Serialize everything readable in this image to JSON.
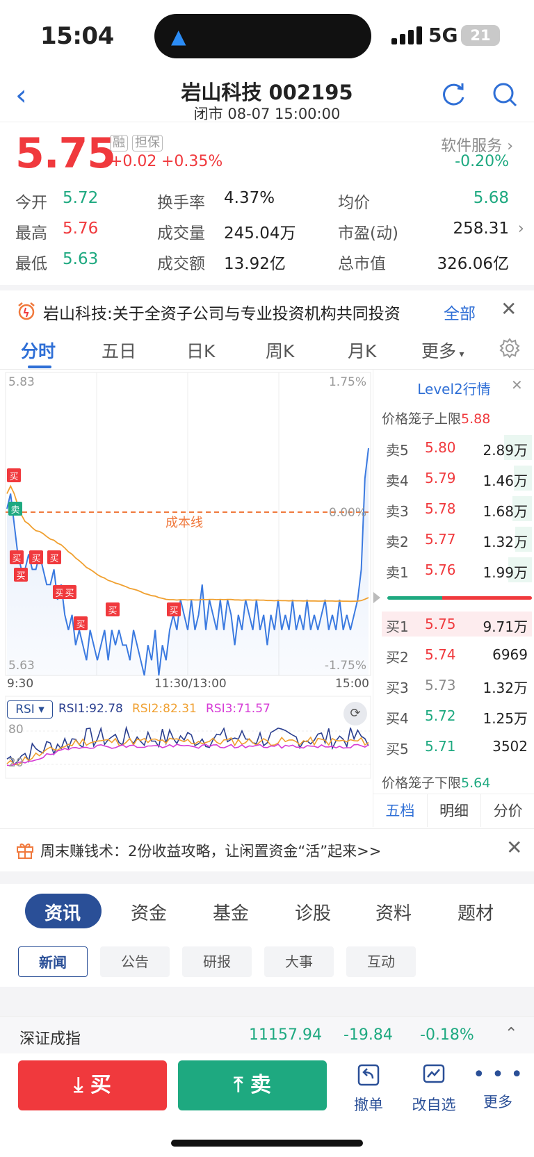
{
  "status": {
    "time": "15:04",
    "network": "5G",
    "battery": "21"
  },
  "header": {
    "title": "岩山科技 002195",
    "subtitle": "闭市 08-07 15:00:00"
  },
  "quote": {
    "price": "5.75",
    "tag1": "融",
    "tag2": "担保",
    "change": "+0.02",
    "change_pct": "+0.35%",
    "sector_name": "软件服务",
    "sector_pct": "-0.20%",
    "stats": [
      {
        "label": "今开",
        "value": "5.72"
      },
      {
        "label": "换手率",
        "value": "4.37%"
      },
      {
        "label": "均价",
        "value": "5.68"
      },
      {
        "label": "最高",
        "value": "5.76"
      },
      {
        "label": "成交量",
        "value": "245.04万"
      },
      {
        "label": "市盈(动)",
        "value": "258.31"
      },
      {
        "label": "最低",
        "value": "5.63"
      },
      {
        "label": "成交额",
        "value": "13.92亿"
      },
      {
        "label": "总市值",
        "value": "326.06亿"
      }
    ]
  },
  "notice": {
    "text": "岩山科技:关于全资子公司与专业投资机构共同投资",
    "all": "全部"
  },
  "ktabs": [
    "分时",
    "五日",
    "日K",
    "周K",
    "月K",
    "更多"
  ],
  "chart": {
    "y_top": "5.83",
    "y_bottom": "5.63",
    "pct_top": "1.75%",
    "pct_mid": "0.00%",
    "pct_bottom": "-1.75%",
    "x_start": "9:30",
    "x_mid": "11:30/13:00",
    "x_end": "15:00",
    "cost_line": "成本线",
    "buy": "买",
    "sell": "卖",
    "rsi_btn": "RSI",
    "rsi1": "RSI1:92.78",
    "rsi2": "RSI2:82.31",
    "rsi3": "RSI3:71.57",
    "rsi_80": "80",
    "rsi_20": "20",
    "colors": {
      "price": "#3b7ae0",
      "avg": "#f0a030",
      "cost": "#f0793d",
      "rsi1": "#2b3f8f",
      "rsi2": "#f0a030",
      "rsi3": "#d63bd6"
    }
  },
  "level2": {
    "title": "Level2行情",
    "upper_label": "价格笼子上限",
    "upper": "5.88",
    "lower_label": "价格笼子下限",
    "lower": "5.64",
    "asks": [
      {
        "k": "卖5",
        "p": "5.80",
        "v": "2.89万"
      },
      {
        "k": "卖4",
        "p": "5.79",
        "v": "1.46万"
      },
      {
        "k": "卖3",
        "p": "5.78",
        "v": "1.68万"
      },
      {
        "k": "卖2",
        "p": "5.77",
        "v": "1.32万"
      },
      {
        "k": "卖1",
        "p": "5.76",
        "v": "1.99万"
      }
    ],
    "bids": [
      {
        "k": "买1",
        "p": "5.75",
        "v": "9.71万"
      },
      {
        "k": "买2",
        "p": "5.74",
        "v": "6969"
      },
      {
        "k": "买3",
        "p": "5.73",
        "v": "1.32万"
      },
      {
        "k": "买4",
        "p": "5.72",
        "v": "1.25万"
      },
      {
        "k": "买5",
        "p": "5.71",
        "v": "3502"
      }
    ],
    "tabs": [
      "五档",
      "明细",
      "分价"
    ]
  },
  "promo": {
    "text": "周末赚钱术：2份收益攻略，让闲置资金“活”起来>>"
  },
  "info_tabs": [
    "资讯",
    "资金",
    "基金",
    "诊股",
    "资料",
    "题材"
  ],
  "sub_tabs": [
    "新闻",
    "公告",
    "研报",
    "大事",
    "互动"
  ],
  "index_bar": {
    "name": "深证成指",
    "value": "11157.94",
    "change": "-19.84",
    "pct": "-0.18%"
  },
  "actions": {
    "buy": "买",
    "sell": "卖",
    "cancel": "撤单",
    "watch": "改自选",
    "more": "更多"
  }
}
